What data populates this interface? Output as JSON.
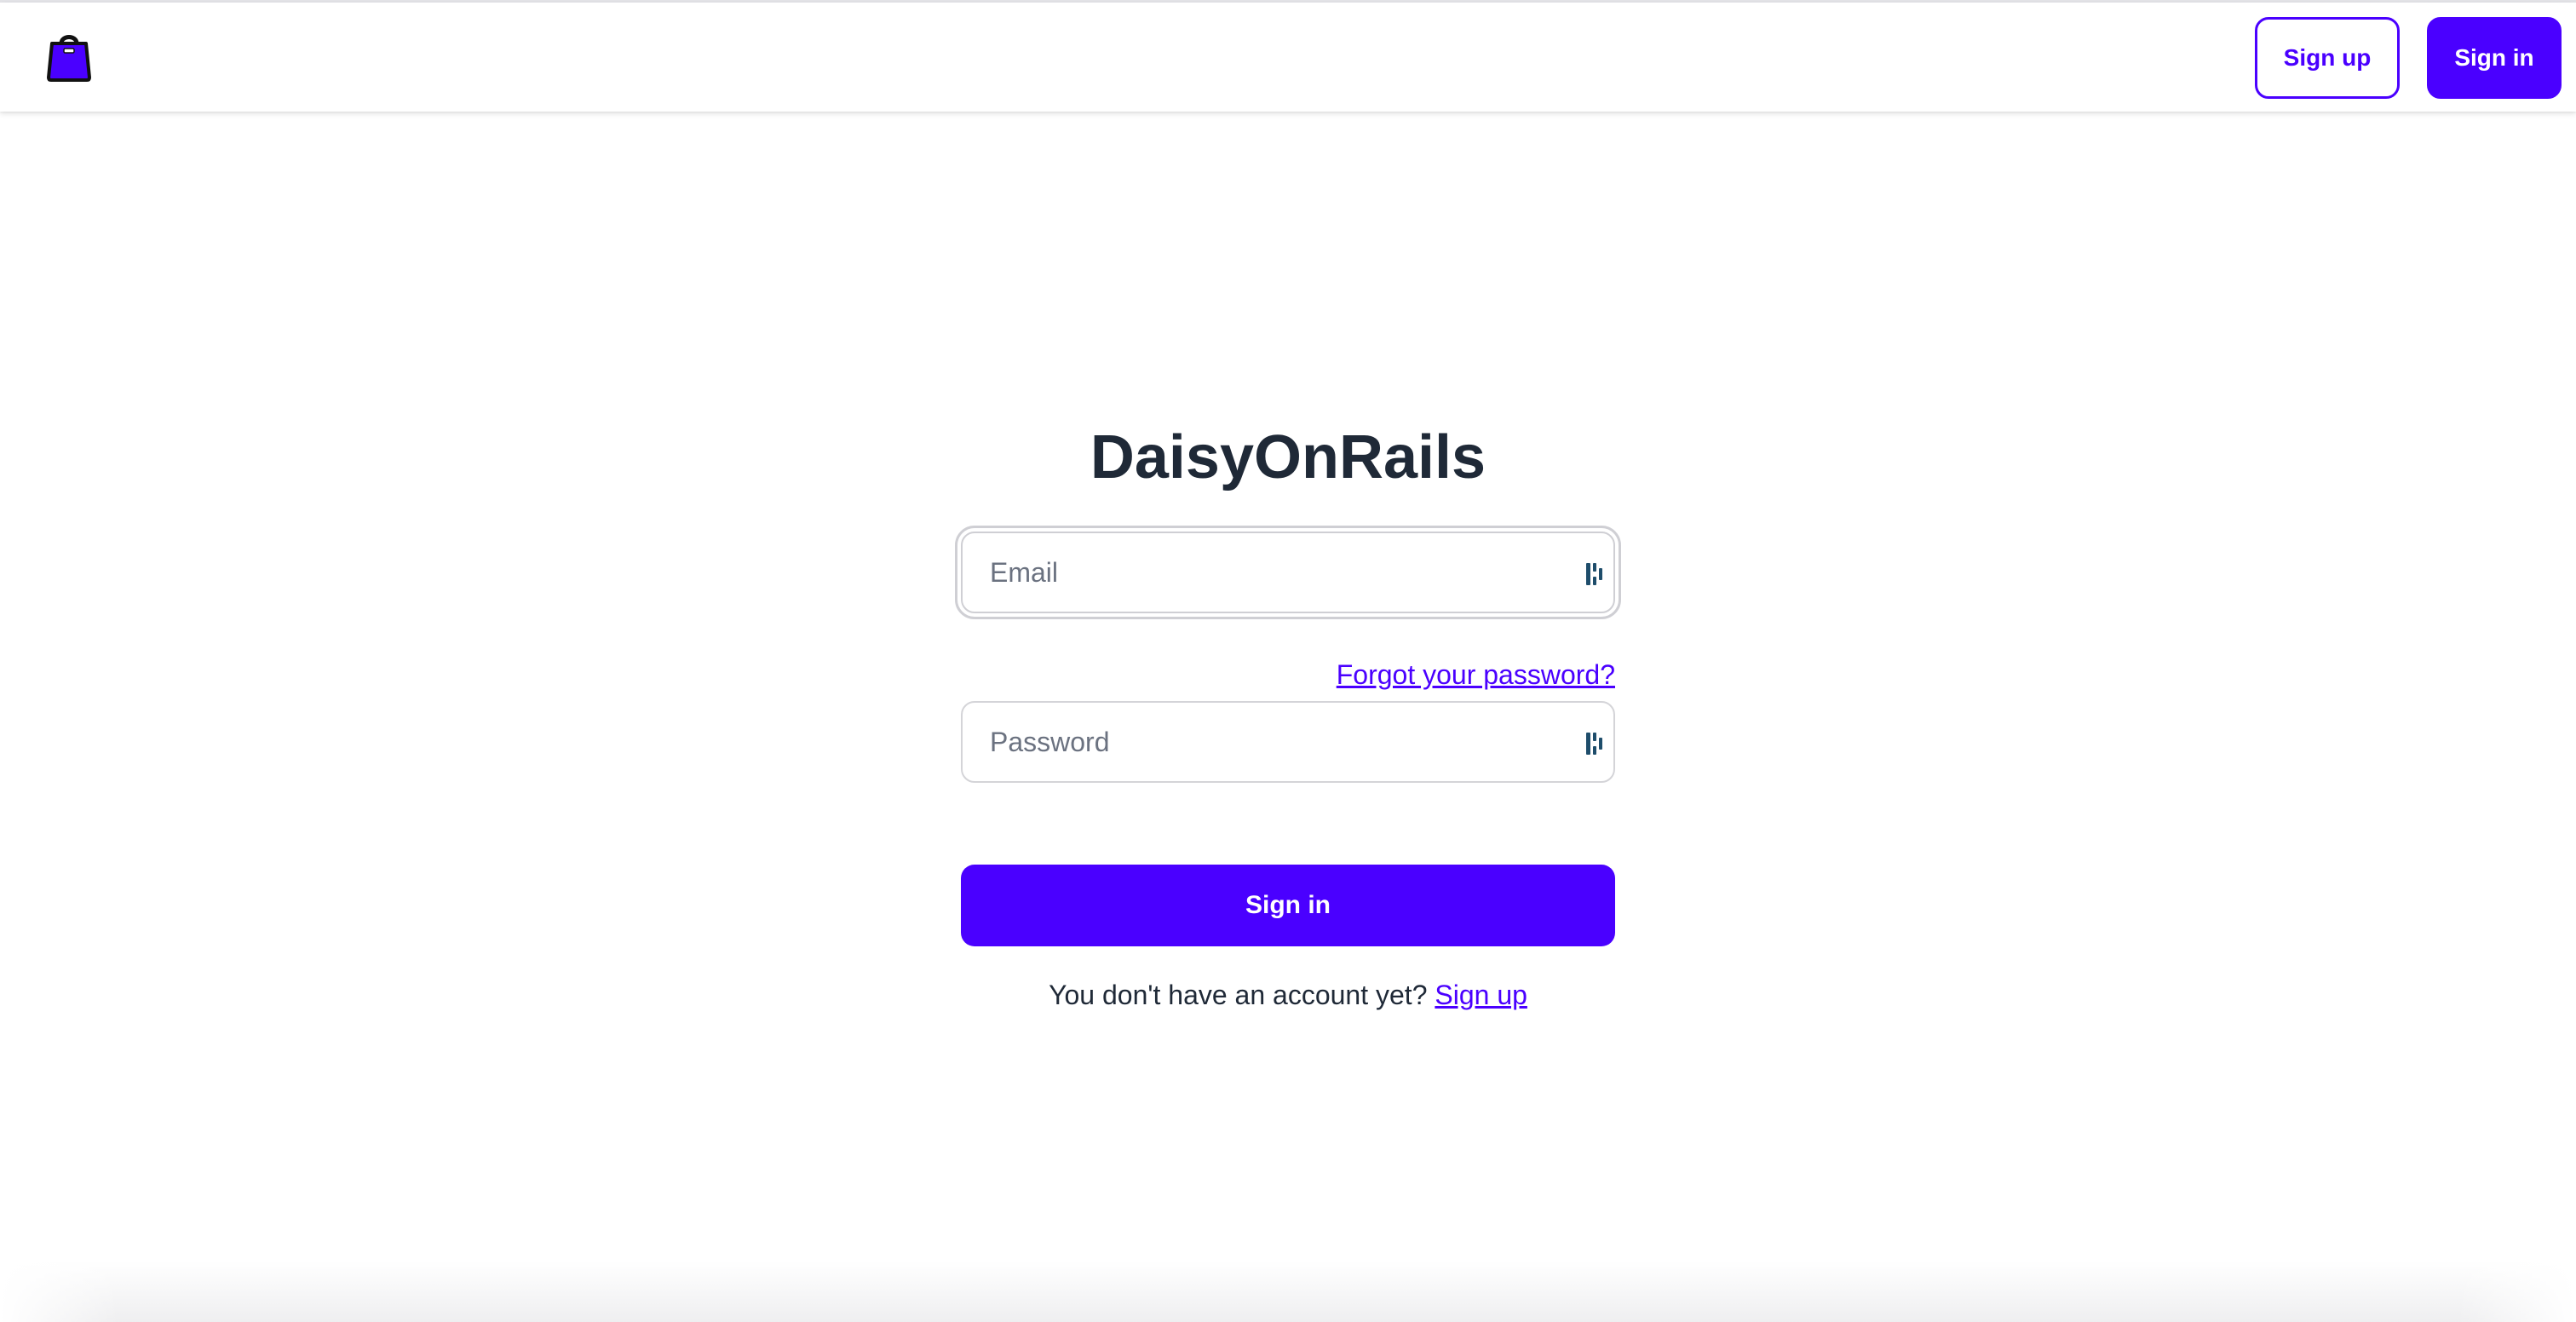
{
  "navbar": {
    "logo_icon": "shopping-bag-icon",
    "sign_up_label": "Sign up",
    "sign_in_label": "Sign in"
  },
  "form": {
    "title": "DaisyOnRails",
    "email": {
      "placeholder": "Email",
      "value": ""
    },
    "forgot_password_label": "Forgot your password?",
    "password": {
      "placeholder": "Password",
      "value": ""
    },
    "submit_label": "Sign in",
    "no_account_text": "You don't have an account yet?",
    "sign_up_link_label": "Sign up",
    "field_icon": "password-manager-icon"
  },
  "colors": {
    "primary": "#4a00ff",
    "text": "#1f2937",
    "placeholder": "#6b7280",
    "border": "#d4d4d8"
  }
}
